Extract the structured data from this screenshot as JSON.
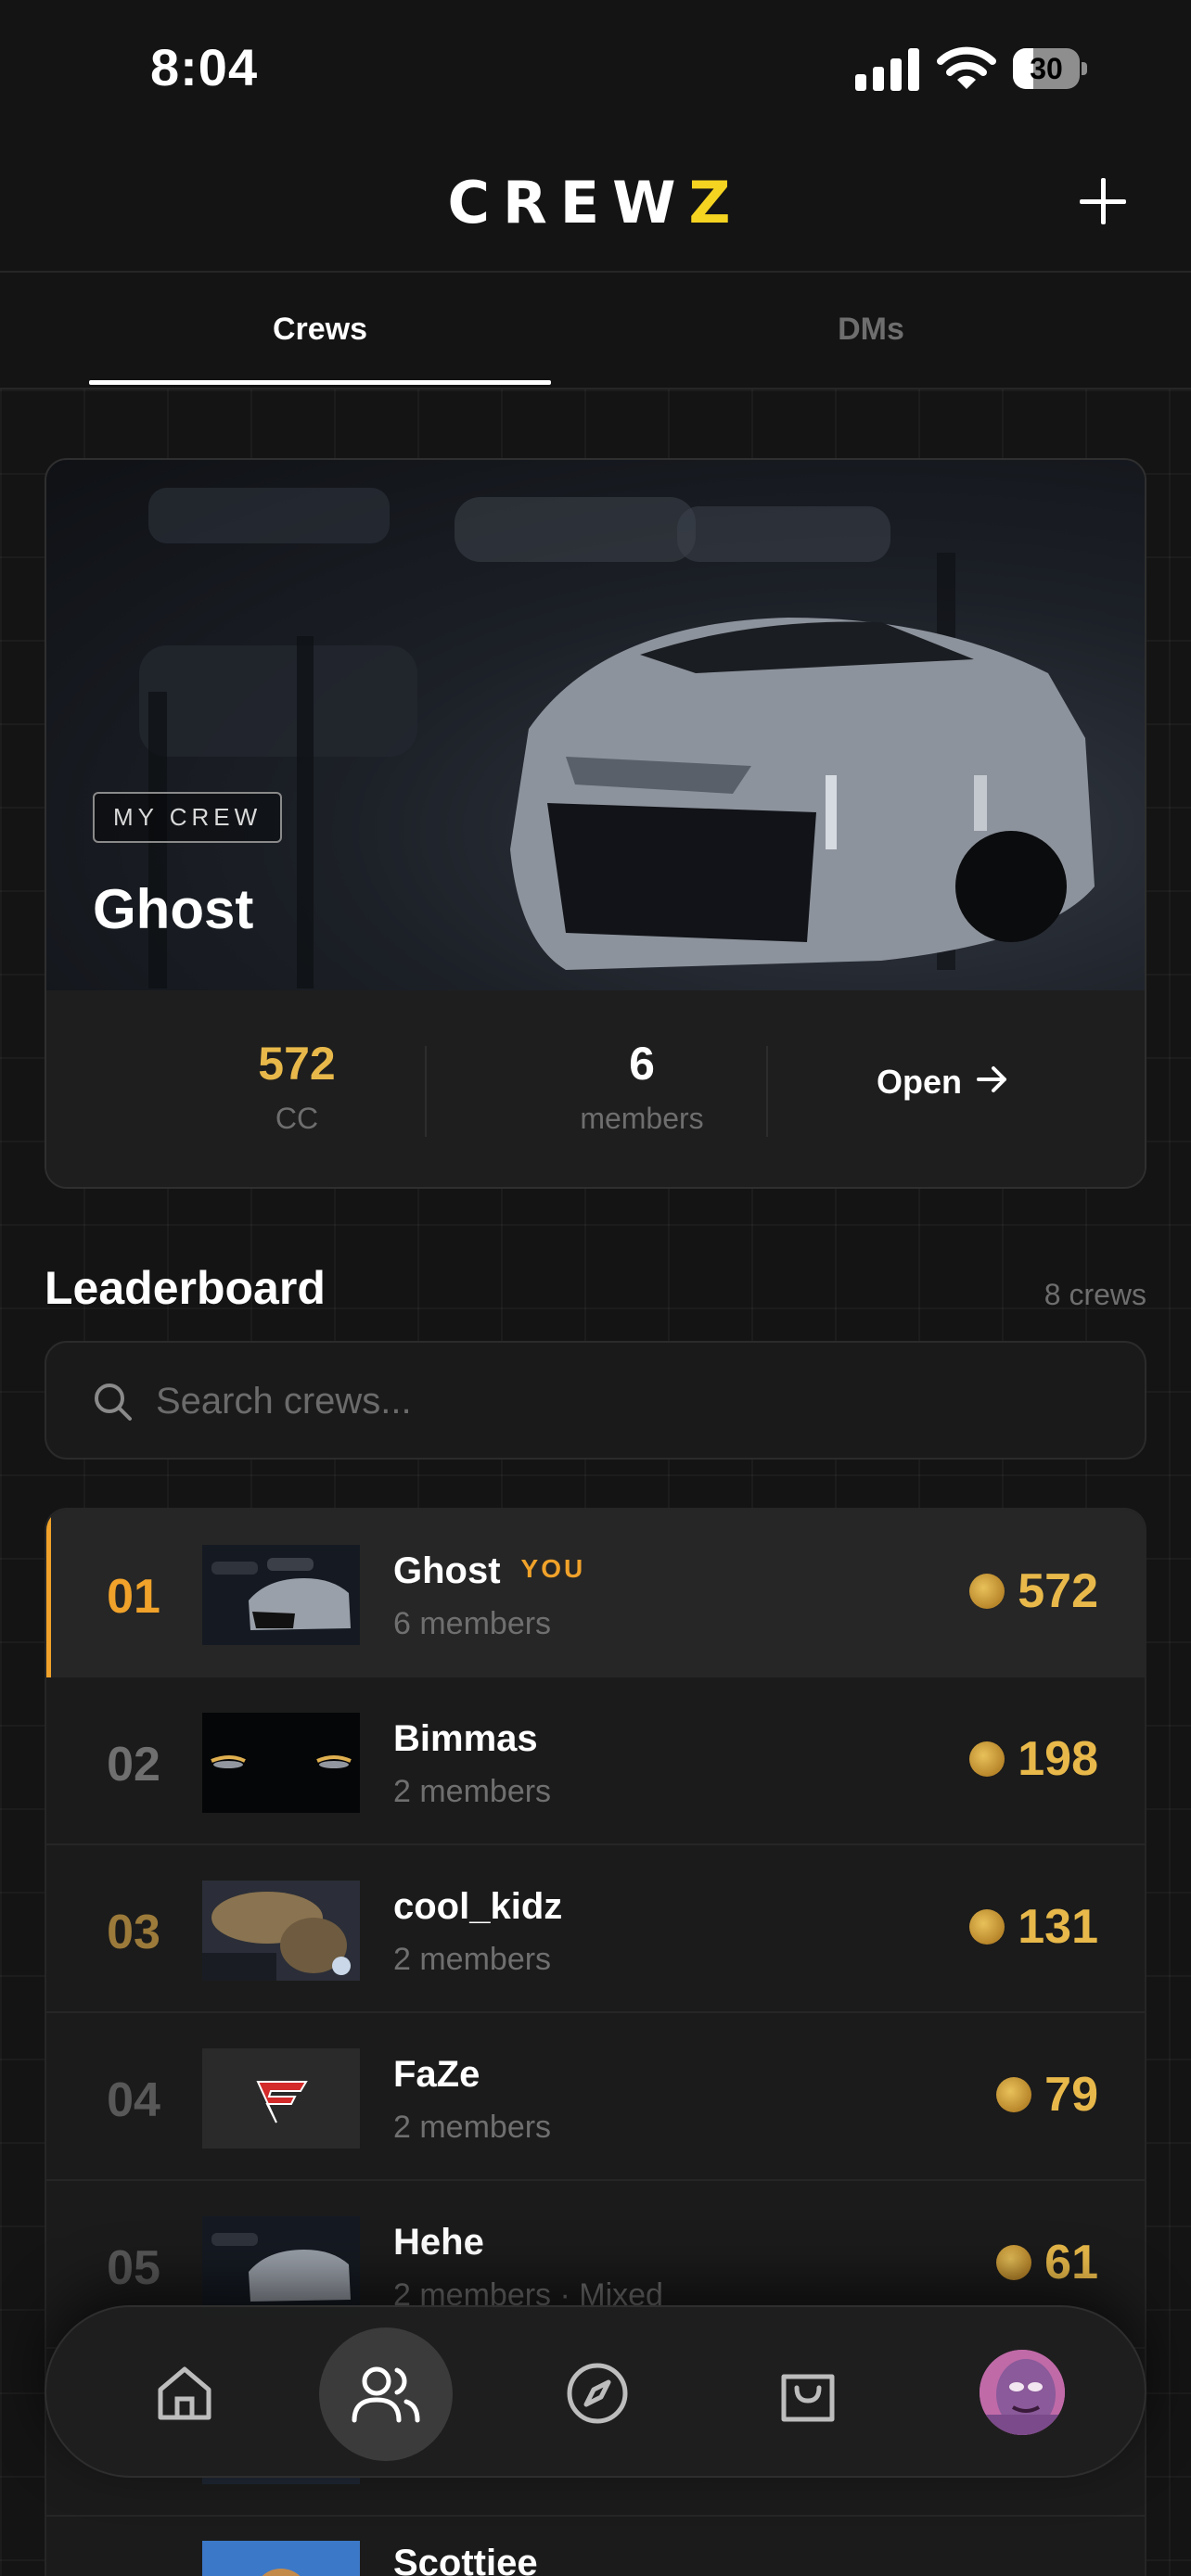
{
  "status_bar": {
    "time": "8:04",
    "battery": "30",
    "battery_level": 0.3
  },
  "header": {
    "brand_main": "CREW",
    "brand_accent": "Z"
  },
  "tabs": [
    {
      "label": "Crews",
      "active": true
    },
    {
      "label": "DMs",
      "active": false
    }
  ],
  "my_crew": {
    "badge": "MY CREW",
    "name": "Ghost",
    "stats": [
      {
        "value": "572",
        "label": "CC"
      },
      {
        "value": "6",
        "label": "members"
      }
    ],
    "open_label": "Open",
    "open_icon": "arrow-right-icon"
  },
  "leaderboard": {
    "title": "Leaderboard",
    "count": "8 crews",
    "search_placeholder": "Search crews...",
    "rows": [
      {
        "rank": "01",
        "name": "Ghost",
        "tag": "YOU",
        "sub": "6 members",
        "score": "572"
      },
      {
        "rank": "02",
        "name": "Bimmas",
        "sub": "2 members",
        "score": "198"
      },
      {
        "rank": "03",
        "name": "cool_kidz",
        "sub": "2 members",
        "score": "131"
      },
      {
        "rank": "04",
        "name": "FaZe",
        "sub": "2 members",
        "score": "79"
      },
      {
        "rank": "05",
        "name": "Hehe",
        "sub": "2 members · Mixed",
        "score": "61"
      },
      {
        "rank": "",
        "name": "",
        "sub": "",
        "score": ""
      },
      {
        "rank": "",
        "name": "Scottiee",
        "sub": "",
        "score": ""
      }
    ]
  },
  "colors": {
    "accent": "#f5d321",
    "gold": "#e8b94a",
    "rank_gold": "#f0a22a",
    "background": "#141414"
  },
  "bottom_nav": [
    {
      "icon": "home-icon"
    },
    {
      "icon": "users-icon",
      "active": true
    },
    {
      "icon": "compass-icon"
    },
    {
      "icon": "shopping-bag-icon"
    },
    {
      "icon": "profile-avatar"
    }
  ]
}
